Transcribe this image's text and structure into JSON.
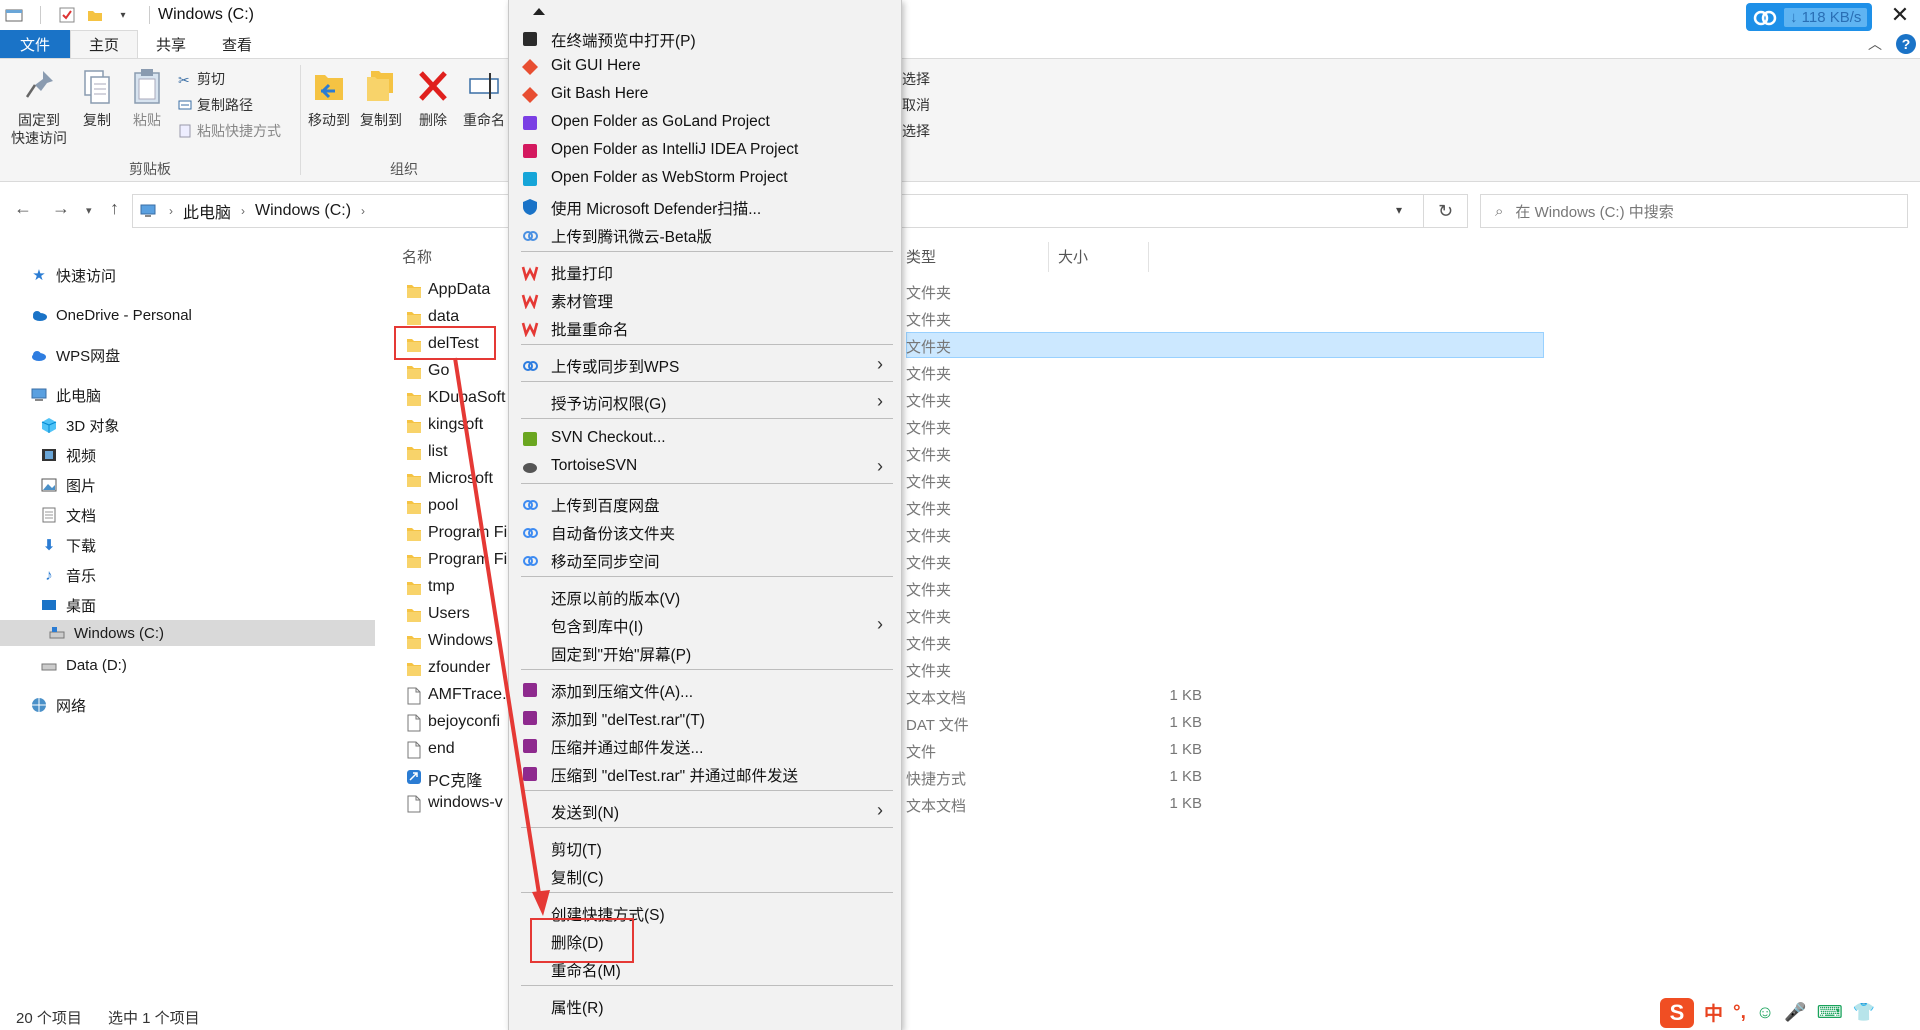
{
  "window": {
    "title": "Windows (C:)"
  },
  "speed_badge": {
    "speed": "118 KB/s"
  },
  "ribbon_tabs": [
    "文件",
    "主页",
    "共享",
    "查看"
  ],
  "ribbon": {
    "clipboard": {
      "pin": "固定到\n快速访问",
      "pin_l1": "固定到",
      "pin_l2": "快速访问",
      "copy": "复制",
      "paste": "粘贴",
      "cut": "剪切",
      "copy_path": "复制路径",
      "paste_shortcut": "粘贴快捷方式",
      "group": "剪贴板"
    },
    "organize": {
      "move_to": "移动到",
      "copy_to": "复制到",
      "delete": "删除",
      "rename": "重命名",
      "group": "组织"
    },
    "select": {
      "select_all": "选择",
      "cancel": "取消",
      "invert": "选择"
    }
  },
  "address": {
    "crumbs": [
      "此电脑",
      "Windows (C:)"
    ],
    "search_placeholder": "在 Windows (C:) 中搜索"
  },
  "sidebar": {
    "items": [
      {
        "label": "快速访问",
        "icon": "star-icon"
      },
      {
        "label": "OneDrive - Personal",
        "icon": "cloud-icon"
      },
      {
        "label": "WPS网盘",
        "icon": "wps-cloud-icon"
      },
      {
        "label": "此电脑",
        "icon": "computer-icon"
      },
      {
        "label": "3D 对象",
        "icon": "cube-icon"
      },
      {
        "label": "视频",
        "icon": "video-icon"
      },
      {
        "label": "图片",
        "icon": "picture-icon"
      },
      {
        "label": "文档",
        "icon": "document-icon"
      },
      {
        "label": "下载",
        "icon": "download-icon"
      },
      {
        "label": "音乐",
        "icon": "music-icon"
      },
      {
        "label": "桌面",
        "icon": "desktop-icon"
      },
      {
        "label": "Windows (C:)",
        "icon": "drive-icon"
      },
      {
        "label": "Data (D:)",
        "icon": "drive-icon"
      },
      {
        "label": "网络",
        "icon": "network-icon"
      }
    ]
  },
  "columns": {
    "name": "名称",
    "type": "类型",
    "size": "大小"
  },
  "files": [
    {
      "name": "AppData",
      "type": "文件夹",
      "size": "",
      "kind": "folder"
    },
    {
      "name": "data",
      "type": "文件夹",
      "size": "",
      "kind": "folder"
    },
    {
      "name": "delTest",
      "type": "文件夹",
      "size": "",
      "kind": "folder"
    },
    {
      "name": "Go",
      "type": "文件夹",
      "size": "",
      "kind": "folder"
    },
    {
      "name": "KDubaSoft",
      "type": "文件夹",
      "size": "",
      "kind": "folder"
    },
    {
      "name": "kingsoft",
      "type": "文件夹",
      "size": "",
      "kind": "folder"
    },
    {
      "name": "list",
      "type": "文件夹",
      "size": "",
      "kind": "folder"
    },
    {
      "name": "Microsoft",
      "type": "文件夹",
      "size": "",
      "kind": "folder"
    },
    {
      "name": "pool",
      "type": "文件夹",
      "size": "",
      "kind": "folder"
    },
    {
      "name": "Program Fi",
      "type": "文件夹",
      "size": "",
      "kind": "folder"
    },
    {
      "name": "Program Fi",
      "type": "文件夹",
      "size": "",
      "kind": "folder"
    },
    {
      "name": "tmp",
      "type": "文件夹",
      "size": "",
      "kind": "folder"
    },
    {
      "name": "Users",
      "type": "文件夹",
      "size": "",
      "kind": "folder"
    },
    {
      "name": "Windows",
      "type": "文件夹",
      "size": "",
      "kind": "folder"
    },
    {
      "name": "zfounder",
      "type": "文件夹",
      "size": "",
      "kind": "folder"
    },
    {
      "name": "AMFTrace.",
      "type": "文本文档",
      "size": "1 KB",
      "kind": "text"
    },
    {
      "name": "bejoyconfi",
      "type": "DAT 文件",
      "size": "1 KB",
      "kind": "dat"
    },
    {
      "name": "end",
      "type": "文件",
      "size": "1 KB",
      "kind": "file"
    },
    {
      "name": "PC克隆",
      "type": "快捷方式",
      "size": "1 KB",
      "kind": "shortcut"
    },
    {
      "name": "windows-v",
      "type": "文本文档",
      "size": "1 KB",
      "kind": "text"
    }
  ],
  "context_menu": {
    "items": [
      {
        "label": "在终端预览中打开(P)",
        "icon": "terminal-icon",
        "arrow": false,
        "color": "#2b2b2b"
      },
      {
        "label": "Git GUI Here",
        "icon": "git-gui-icon",
        "arrow": false,
        "color": "#e84e31"
      },
      {
        "label": "Git Bash Here",
        "icon": "git-bash-icon",
        "arrow": false,
        "color": "#e84e31"
      },
      {
        "label": "Open Folder as GoLand Project",
        "icon": "goland-icon",
        "arrow": false,
        "color": "#7b3fe4"
      },
      {
        "label": "Open Folder as IntelliJ IDEA Project",
        "icon": "intellij-icon",
        "arrow": false,
        "color": "#d4195f"
      },
      {
        "label": "Open Folder as WebStorm Project",
        "icon": "webstorm-icon",
        "arrow": false,
        "color": "#16a5d8"
      },
      {
        "label": "使用 Microsoft Defender扫描...",
        "icon": "defender-icon",
        "arrow": false,
        "color": "#1a73c7"
      },
      {
        "label": "上传到腾讯微云-Beta版",
        "icon": "weiyun-icon",
        "arrow": false,
        "color": "#4a90e2"
      },
      {
        "label": "批量打印",
        "icon": "wps-icon",
        "arrow": false,
        "color": "#e53935"
      },
      {
        "label": "素材管理",
        "icon": "wps-icon",
        "arrow": false,
        "color": "#e53935"
      },
      {
        "label": "批量重命名",
        "icon": "wps-icon",
        "arrow": false,
        "color": "#e53935"
      },
      {
        "label": "上传或同步到WPS",
        "icon": "wps-upload-icon",
        "arrow": true,
        "color": "#2e7de0"
      },
      {
        "label": "授予访问权限(G)",
        "icon": "",
        "arrow": true,
        "color": ""
      },
      {
        "label": "SVN Checkout...",
        "icon": "svn-checkout-icon",
        "arrow": false,
        "color": "#6aa620"
      },
      {
        "label": "TortoiseSVN",
        "icon": "tortoisesvn-icon",
        "arrow": true,
        "color": "#555555"
      },
      {
        "label": "上传到百度网盘",
        "icon": "baidu-cloud-icon",
        "arrow": false,
        "color": "#3d8bf2"
      },
      {
        "label": "自动备份该文件夹",
        "icon": "baidu-cloud-icon",
        "arrow": false,
        "color": "#3d8bf2"
      },
      {
        "label": "移动至同步空间",
        "icon": "baidu-cloud-icon",
        "arrow": false,
        "color": "#3d8bf2"
      },
      {
        "label": "还原以前的版本(V)",
        "icon": "",
        "arrow": false,
        "color": ""
      },
      {
        "label": "包含到库中(I)",
        "icon": "",
        "arrow": true,
        "color": ""
      },
      {
        "label": "固定到\"开始\"屏幕(P)",
        "icon": "",
        "arrow": false,
        "color": ""
      },
      {
        "label": "添加到压缩文件(A)...",
        "icon": "winrar-icon",
        "arrow": false,
        "color": "#8e2a8e"
      },
      {
        "label": "添加到 \"delTest.rar\"(T)",
        "icon": "winrar-icon",
        "arrow": false,
        "color": "#8e2a8e"
      },
      {
        "label": "压缩并通过邮件发送...",
        "icon": "winrar-icon",
        "arrow": false,
        "color": "#8e2a8e"
      },
      {
        "label": "压缩到 \"delTest.rar\" 并通过邮件发送",
        "icon": "winrar-icon",
        "arrow": false,
        "color": "#8e2a8e"
      },
      {
        "label": "发送到(N)",
        "icon": "",
        "arrow": true,
        "color": ""
      },
      {
        "label": "剪切(T)",
        "icon": "",
        "arrow": false,
        "color": ""
      },
      {
        "label": "复制(C)",
        "icon": "",
        "arrow": false,
        "color": ""
      },
      {
        "label": "创建快捷方式(S)",
        "icon": "",
        "arrow": false,
        "color": ""
      },
      {
        "label": "删除(D)",
        "icon": "",
        "arrow": false,
        "color": ""
      },
      {
        "label": "重命名(M)",
        "icon": "",
        "arrow": false,
        "color": ""
      },
      {
        "label": "属性(R)",
        "icon": "",
        "arrow": false,
        "color": ""
      }
    ]
  },
  "status": {
    "count": "20 个项目",
    "selected": "选中 1 个项目"
  },
  "ime": {
    "mode": "中",
    "punct": "°,"
  },
  "colors": {
    "accent": "#1a73c7",
    "selection": "#cce8ff",
    "annotation": "#e53935",
    "folder": "#f5c343"
  }
}
